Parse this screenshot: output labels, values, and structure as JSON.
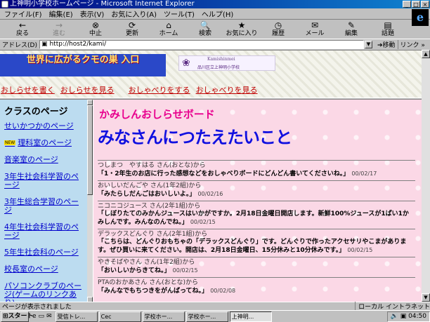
{
  "window": {
    "title": "上神明小学校ホームページ - Microsoft Internet Explorer"
  },
  "menu": [
    "ファイル(F)",
    "編集(E)",
    "表示(V)",
    "お気に入り(A)",
    "ツール(T)",
    "ヘルプ(H)"
  ],
  "toolbar": [
    {
      "label": "戻る",
      "icon": "←"
    },
    {
      "label": "進む",
      "icon": "→"
    },
    {
      "label": "中止",
      "icon": "⊗"
    },
    {
      "label": "更新",
      "icon": "⟳"
    },
    {
      "label": "ホーム",
      "icon": "⌂"
    },
    {
      "label": "検索",
      "icon": "🔍"
    },
    {
      "label": "お気に入り",
      "icon": "★"
    },
    {
      "label": "履歴",
      "icon": "◷"
    },
    {
      "label": "メール",
      "icon": "✉"
    },
    {
      "label": "編集",
      "icon": "✎"
    },
    {
      "label": "話題",
      "icon": "▤"
    }
  ],
  "address": {
    "label": "アドレス(D)",
    "url": "http://host2/kami/",
    "go": "移動",
    "links": "リンク »"
  },
  "banner": {
    "left_text": "世界に広がるクモの巣 入口",
    "school_en": "Kamishinmei",
    "school_jp": "品川区立上神明小学校"
  },
  "nav_links": [
    "おしらせを書く",
    "おしらせを見る",
    "おしゃべりをする",
    "おしゃべりを見る"
  ],
  "left": {
    "title": "クラスのページ",
    "new_badge": "NEW",
    "items": [
      "せいかつかのページ",
      "理科室のページ",
      "音楽室のページ",
      "3年生社会科学習のページ",
      "3年生総合学習のページ",
      "4年生社会科学習のページ",
      "5年生社会科のページ",
      "校長室のページ",
      "パソコンクラブのページ(ゲームのリンクあり)"
    ]
  },
  "board": {
    "title": "かみしんおしらせボード",
    "heading": "みなさんにつたえたいこと",
    "messages": [
      {
        "author": "つしまつ　やすはる さん(おとな)から",
        "body": "「1・2年生のお店に行った感想などをおしゃべりボードにどんどん書いてくださいね。」",
        "date": "00/02/17"
      },
      {
        "author": "おいしいだんごや さん(1年2組)から",
        "body": "「みたらしだんごはおいしいよ。」",
        "date": "00/02/16"
      },
      {
        "author": "ニコニコジュース さん(2年1組)から",
        "body": "「しぼりたてのみかんジュースはいかがですか。2月18日金曜日開店します。新鮮100%ジュースが1ぱい1かみしんです。みんなのんでね。」",
        "date": "00/02/15"
      },
      {
        "author": "デラックスどんぐり さん(2年1組)から",
        "body": "「こちらは、どんぐりおもちゃの「デラックスどんぐり」です。どんぐりで作ったアクセサリやこまがあります。ぜひ買いに来てください。開店は、2月18日金曜日、15分休みと10分休みです。」",
        "date": "00/02/15"
      },
      {
        "author": "やきそばやさん さん(1年2組)から",
        "body": "「おいしいからきてね。」",
        "date": "00/02/15"
      },
      {
        "author": "PTAのおかあさん さん(おとな)から",
        "body": "「みんなでもちつきをがんばってね。」",
        "date": "00/02/08"
      }
    ]
  },
  "status": {
    "text": "ページが表示されました",
    "zone": "ローカル イントラネット"
  },
  "taskbar": {
    "start": "スタート",
    "tasks": [
      "受信トレ...",
      "Cec",
      "学校ホー...",
      "学校ホー...",
      "上神明..."
    ],
    "active_index": 4,
    "clock": "04:50"
  }
}
